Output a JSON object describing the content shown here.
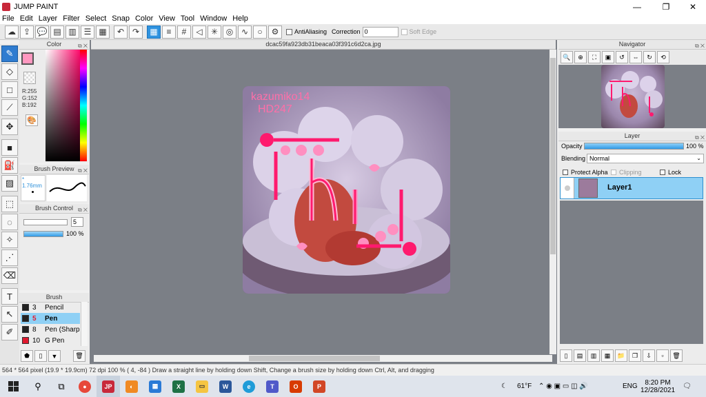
{
  "window": {
    "title": "JUMP PAINT"
  },
  "menu": [
    "File",
    "Edit",
    "Layer",
    "Filter",
    "Select",
    "Snap",
    "Color",
    "View",
    "Tool",
    "Window",
    "Help"
  ],
  "toolbar": {
    "antialiasing_label": "AntiAliasing",
    "correction_label": "Correction",
    "correction_value": "0",
    "soft_edge_label": "Soft Edge"
  },
  "color_panel": {
    "title": "Color",
    "current_color": "#ff98c0",
    "r": "R:255",
    "g": "G:152",
    "b": "B:192"
  },
  "brush_preview": {
    "title": "Brush Preview",
    "size": "* 1.76mm"
  },
  "brush_control": {
    "title": "Brush Control",
    "size_value": "5",
    "opacity_value": "100 %"
  },
  "brush_list": {
    "title": "Brush",
    "items": [
      {
        "num": "3",
        "name": "Pencil",
        "color": "#222222"
      },
      {
        "num": "5",
        "name": "Pen",
        "color": "#222222"
      },
      {
        "num": "8",
        "name": "Pen (Sharp",
        "color": "#222222"
      },
      {
        "num": "10",
        "name": "G Pen",
        "color": "#e0192f"
      }
    ]
  },
  "document": {
    "tab_title": "dcac59fa923db31beaca03f391c6d2ca.jpg"
  },
  "navigator": {
    "title": "Navigator"
  },
  "layer_panel": {
    "title": "Layer",
    "opacity_label": "Opacity",
    "opacity_value": "100 %",
    "blending_label": "Blending",
    "blending_value": "Normal",
    "protect_alpha_label": "Protect Alpha",
    "clipping_label": "Clipping",
    "lock_label": "Lock",
    "layer_name": "Layer1"
  },
  "statusbar": {
    "text": "564 * 564 pixel   (19.9 * 19.9cm)   72 dpi   100 %   ( 4, -84 )   Draw a straight line by holding down Shift, Change a brush size by holding down Ctrl, Alt, and dragging"
  },
  "artwork": {
    "watermark": "kazumiko14\nHD247",
    "word": "hi",
    "accent": "#ff1a6e",
    "light_accent": "#ff8fc0"
  },
  "taskbar": {
    "temperature": "61°F",
    "language": "ENG",
    "time": "8:20 PM",
    "date": "12/28/2021"
  }
}
